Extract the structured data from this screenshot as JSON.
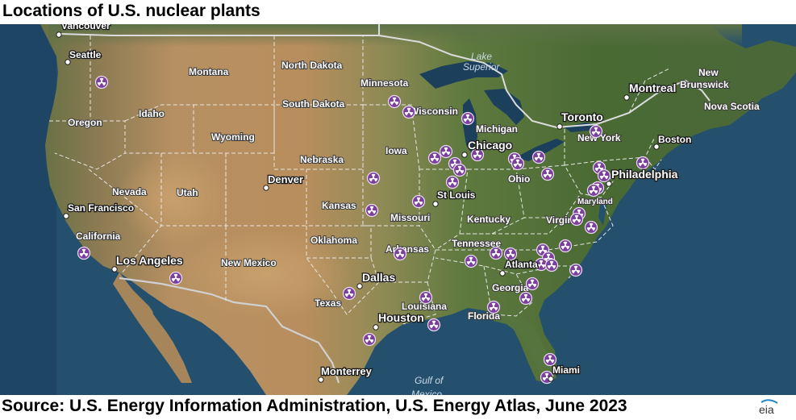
{
  "title": "Locations of U.S. nuclear plants",
  "source": "Source: U.S. Energy Information Administration, U.S. Energy Atlas, June 2023",
  "logo_text": "eia",
  "colors": {
    "ocean": "#24506e",
    "land_west": "#b38a5c",
    "land_east": "#4e6b36",
    "plant_marker": "#7b3f9c",
    "border": "#e8e8e8"
  },
  "marker_icon": "nuclear-plant-icon",
  "cities": [
    {
      "id": "vancouver",
      "name": "Vancouver"
    },
    {
      "id": "seattle",
      "name": "Seattle"
    },
    {
      "id": "san-francisco",
      "name": "San Francisco"
    },
    {
      "id": "los-angeles",
      "name": "Los Angeles"
    },
    {
      "id": "denver",
      "name": "Denver"
    },
    {
      "id": "dallas",
      "name": "Dallas"
    },
    {
      "id": "houston",
      "name": "Houston"
    },
    {
      "id": "monterrey",
      "name": "Monterrey"
    },
    {
      "id": "chicago",
      "name": "Chicago"
    },
    {
      "id": "st-louis",
      "name": "St Louis"
    },
    {
      "id": "atlanta",
      "name": "Atlanta"
    },
    {
      "id": "miami",
      "name": "Miami"
    },
    {
      "id": "toronto",
      "name": "Toronto"
    },
    {
      "id": "montreal",
      "name": "Montreal"
    },
    {
      "id": "boston",
      "name": "Boston"
    },
    {
      "id": "philadelphia",
      "name": "Philadelphia"
    }
  ],
  "regions": [
    {
      "id": "montana",
      "name": "Montana"
    },
    {
      "id": "north-dakota",
      "name": "North Dakota"
    },
    {
      "id": "south-dakota",
      "name": "South Dakota"
    },
    {
      "id": "minnesota",
      "name": "Minnesota"
    },
    {
      "id": "wisconsin",
      "name": "Wisconsin"
    },
    {
      "id": "michigan",
      "name": "Michigan"
    },
    {
      "id": "oregon",
      "name": "Oregon"
    },
    {
      "id": "idaho",
      "name": "Idaho"
    },
    {
      "id": "wyoming",
      "name": "Wyoming"
    },
    {
      "id": "nebraska",
      "name": "Nebraska"
    },
    {
      "id": "iowa",
      "name": "Iowa"
    },
    {
      "id": "nevada",
      "name": "Nevada"
    },
    {
      "id": "utah",
      "name": "Utah"
    },
    {
      "id": "california",
      "name": "California"
    },
    {
      "id": "kansas",
      "name": "Kansas"
    },
    {
      "id": "missouri",
      "name": "Missouri"
    },
    {
      "id": "oklahoma",
      "name": "Oklahoma"
    },
    {
      "id": "new-mexico",
      "name": "New Mexico"
    },
    {
      "id": "arkansas",
      "name": "Arkansas"
    },
    {
      "id": "texas",
      "name": "Texas"
    },
    {
      "id": "louisiana",
      "name": "Louisiana"
    },
    {
      "id": "tennessee",
      "name": "Tennessee"
    },
    {
      "id": "kentucky",
      "name": "Kentucky"
    },
    {
      "id": "ohio",
      "name": "Ohio"
    },
    {
      "id": "virginia",
      "name": "Virginia"
    },
    {
      "id": "maryland",
      "name": "Maryland"
    },
    {
      "id": "georgia",
      "name": "Georgia"
    },
    {
      "id": "florida",
      "name": "Florida"
    },
    {
      "id": "new-york",
      "name": "New York"
    },
    {
      "id": "new-brunswick",
      "name": "New\nBrunswick"
    },
    {
      "id": "nova-scotia",
      "name": "Nova Scotia"
    }
  ],
  "water_labels": [
    {
      "id": "lake-superior",
      "name": "Lake\nSuperior"
    },
    {
      "id": "gulf-of-mexico",
      "name": "Gulf of\nMexico"
    }
  ]
}
